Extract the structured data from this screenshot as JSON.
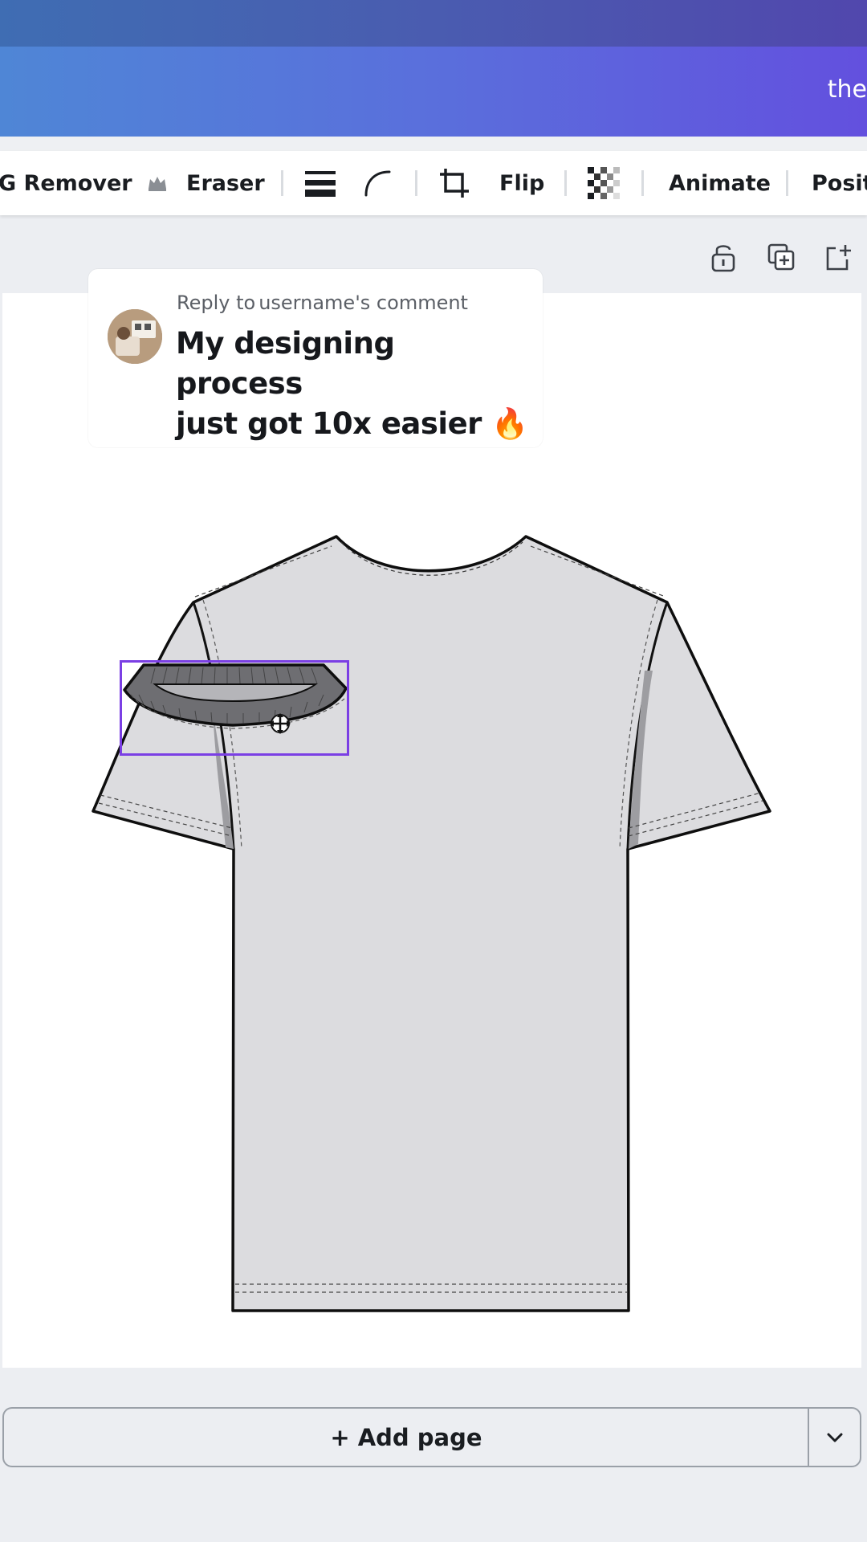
{
  "header": {
    "title": "the"
  },
  "toolbar": {
    "bg_remover_label": "G Remover",
    "eraser_label": "Eraser",
    "flip_label": "Flip",
    "animate_label": "Animate",
    "position_label": "Posit"
  },
  "page_actions": {
    "icons": [
      "unlock-icon",
      "duplicate-page-icon",
      "add-page-icon"
    ]
  },
  "comment": {
    "reply_prefix": "Reply to",
    "reply_username": "username",
    "reply_suffix": "'s comment",
    "text_line1": "My designing process",
    "text_line2": "just got 10x easier 🔥"
  },
  "footer": {
    "add_page_label": "Add page",
    "add_page_plus": "+"
  },
  "colors": {
    "accent": "#7b3fe4",
    "header_gradient_start": "#4f86d6",
    "header_gradient_end": "#6350de"
  }
}
